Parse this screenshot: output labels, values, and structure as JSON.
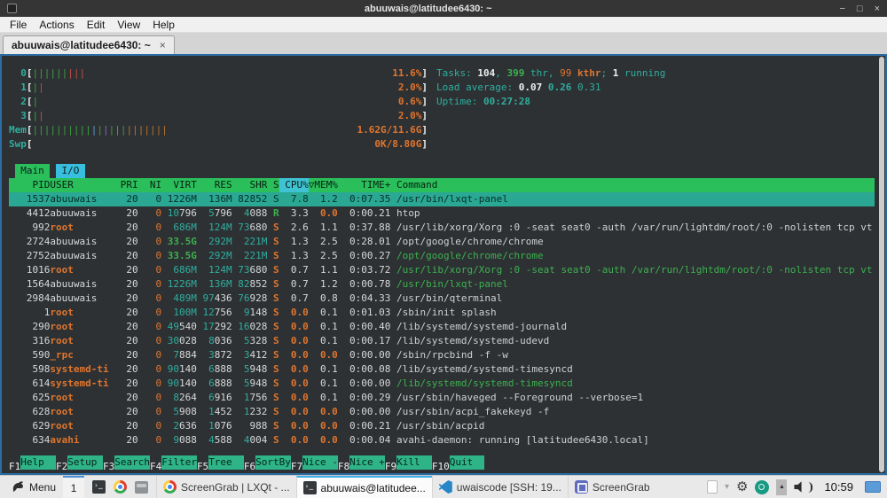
{
  "colors": {
    "terminal_bg": "#2d3134",
    "terminal_border_blue": "#2d6ca3",
    "header_green": "#2abf5b",
    "sort_col_cyan": "#3fc2d4",
    "io_tab_cyan": "#38bfe0",
    "selection_teal": "#2aa893",
    "fnlabel_teal": "#2eb487",
    "text_teal": "#2fae9e",
    "text_green": "#3db04f",
    "text_orange": "#e0752d",
    "taskbar_accent_blue": "#3daee9"
  },
  "window": {
    "title": "abuuwais@latitudee6430: ~",
    "controls": [
      "−",
      "□",
      "×"
    ]
  },
  "menubar": {
    "items": [
      "File",
      "Actions",
      "Edit",
      "View",
      "Help"
    ]
  },
  "tabbar": {
    "tabs": [
      {
        "label": "abuuwais@latitudee6430: ~",
        "close": "×",
        "active": true
      }
    ]
  },
  "htop": {
    "meters": [
      {
        "label": "0",
        "pct": "11.6%",
        "bars": [
          "g",
          "g",
          "g",
          "g",
          "g",
          "g",
          "r",
          "r",
          "r"
        ]
      },
      {
        "label": "1",
        "pct": "2.0%",
        "bars": [
          "g",
          "r"
        ]
      },
      {
        "label": "2",
        "pct": "0.6%",
        "bars": [
          "g"
        ]
      },
      {
        "label": "3",
        "pct": "2.0%",
        "bars": [
          "g",
          "r"
        ]
      },
      {
        "label": "Mem",
        "pct": "1.62G/11.6G",
        "bars": [
          "g",
          "g",
          "g",
          "g",
          "g",
          "g",
          "g",
          "g",
          "g",
          "g",
          "b",
          "g",
          "p",
          "g",
          "o",
          "g",
          "o",
          "o",
          "o",
          "o",
          "o",
          "o",
          "o"
        ]
      },
      {
        "label": "Swp",
        "pct": "0K/8.80G",
        "bars": []
      }
    ],
    "info_lines": [
      {
        "name": "tasks-summary",
        "spans": [
          [
            "Tasks: ",
            "t"
          ],
          [
            "104",
            "wb"
          ],
          [
            ", ",
            "t"
          ],
          [
            "399",
            "gb"
          ],
          [
            " thr, ",
            "t"
          ],
          [
            "99",
            "o"
          ],
          [
            " kthr",
            "ob"
          ],
          [
            "; ",
            "t"
          ],
          [
            "1",
            "wb"
          ],
          [
            " running",
            "t"
          ]
        ]
      },
      {
        "name": "load-average",
        "spans": [
          [
            "Load average: ",
            "t"
          ],
          [
            "0.07",
            "wb"
          ],
          [
            " ",
            "t"
          ],
          [
            "0.26",
            "tb"
          ],
          [
            " ",
            "t"
          ],
          [
            "0.31",
            "t"
          ]
        ]
      },
      {
        "name": "uptime",
        "spans": [
          [
            "Uptime: ",
            "t"
          ],
          [
            "00:27:28",
            "tb"
          ]
        ]
      }
    ],
    "tabs": [
      {
        "label": "Main",
        "style": "green"
      },
      {
        "label": "I/O",
        "style": "cyan"
      }
    ],
    "columns": [
      {
        "label": "PID",
        "w": 7,
        "align": "r"
      },
      {
        "label": "USER",
        "w": 11,
        "align": "l",
        "pad": 1
      },
      {
        "label": "PRI",
        "w": 4,
        "align": "r"
      },
      {
        "label": "NI",
        "w": 4,
        "align": "r"
      },
      {
        "label": "VIRT",
        "w": 6,
        "align": "r"
      },
      {
        "label": "RES",
        "w": 6,
        "align": "r"
      },
      {
        "label": "SHR",
        "w": 6,
        "align": "r"
      },
      {
        "label": "S",
        "w": 2,
        "align": "r"
      },
      {
        "label": "CPU%",
        "w": 5,
        "align": "r",
        "sort": true
      },
      {
        "label": "▽MEM%",
        "w": 5,
        "align": "r"
      },
      {
        "label": "TIME+",
        "w": 9,
        "align": "r"
      },
      {
        "label": "Command",
        "w": 0,
        "align": "l",
        "flex": true
      }
    ],
    "rows": [
      {
        "pid": "1537",
        "user": "abuuwais",
        "pri": "20",
        "ni": "0",
        "virt": "1226M",
        "res": "136M",
        "shr": "82852",
        "st": "S",
        "cpu": "7.8",
        "mem": "1.2",
        "time": "0:07.35",
        "cmd": "/usr/bin/lxqt-panel",
        "sel": true
      },
      {
        "pid": "4412",
        "user": "abuuwais",
        "pri": "20",
        "ni": "0",
        "virt": "10796",
        "res": "5796",
        "shr": "4088",
        "st": "R",
        "cpu": "3.3",
        "mem": "0.0",
        "time": "0:00.21",
        "cmd": "htop"
      },
      {
        "pid": "992",
        "user": "root",
        "pri": "20",
        "ni": "0",
        "virt": "686M",
        "res": "124M",
        "shr": "73680",
        "st": "S",
        "cpu": "2.6",
        "mem": "1.1",
        "time": "0:37.88",
        "cmd": "/usr/lib/xorg/Xorg :0 -seat seat0 -auth /var/run/lightdm/root/:0 -nolisten tcp vt"
      },
      {
        "pid": "2724",
        "user": "abuuwais",
        "pri": "20",
        "ni": "0",
        "virt": "33.5G",
        "res": "292M",
        "shr": "221M",
        "st": "S",
        "cpu": "1.3",
        "mem": "2.5",
        "time": "0:28.01",
        "cmd": "/opt/google/chrome/chrome"
      },
      {
        "pid": "2752",
        "user": "abuuwais",
        "pri": "20",
        "ni": "0",
        "virt": "33.5G",
        "res": "292M",
        "shr": "221M",
        "st": "S",
        "cpu": "1.3",
        "mem": "2.5",
        "time": "0:00.27",
        "cmd": "/opt/google/chrome/chrome",
        "green_cmd": true
      },
      {
        "pid": "1016",
        "user": "root",
        "pri": "20",
        "ni": "0",
        "virt": "686M",
        "res": "124M",
        "shr": "73680",
        "st": "S",
        "cpu": "0.7",
        "mem": "1.1",
        "time": "0:03.72",
        "cmd": "/usr/lib/xorg/Xorg :0 -seat seat0 -auth /var/run/lightdm/root/:0 -nolisten tcp vt",
        "green_cmd": true
      },
      {
        "pid": "1564",
        "user": "abuuwais",
        "pri": "20",
        "ni": "0",
        "virt": "1226M",
        "res": "136M",
        "shr": "82852",
        "st": "S",
        "cpu": "0.7",
        "mem": "1.2",
        "time": "0:00.78",
        "cmd": "/usr/bin/lxqt-panel",
        "green_cmd": true
      },
      {
        "pid": "2984",
        "user": "abuuwais",
        "pri": "20",
        "ni": "0",
        "virt": "489M",
        "res": "97436",
        "shr": "76928",
        "st": "S",
        "cpu": "0.7",
        "mem": "0.8",
        "time": "0:04.33",
        "cmd": "/usr/bin/qterminal"
      },
      {
        "pid": "1",
        "user": "root",
        "pri": "20",
        "ni": "0",
        "virt": "100M",
        "res": "12756",
        "shr": "9148",
        "st": "S",
        "cpu": "0.0",
        "mem": "0.1",
        "time": "0:01.03",
        "cmd": "/sbin/init splash"
      },
      {
        "pid": "290",
        "user": "root",
        "pri": "20",
        "ni": "0",
        "virt": "49540",
        "res": "17292",
        "shr": "16028",
        "st": "S",
        "cpu": "0.0",
        "mem": "0.1",
        "time": "0:00.40",
        "cmd": "/lib/systemd/systemd-journald"
      },
      {
        "pid": "316",
        "user": "root",
        "pri": "20",
        "ni": "0",
        "virt": "30028",
        "res": "8036",
        "shr": "5328",
        "st": "S",
        "cpu": "0.0",
        "mem": "0.1",
        "time": "0:00.17",
        "cmd": "/lib/systemd/systemd-udevd"
      },
      {
        "pid": "590",
        "user": "_rpc",
        "pri": "20",
        "ni": "0",
        "virt": "7884",
        "res": "3872",
        "shr": "3412",
        "st": "S",
        "cpu": "0.0",
        "mem": "0.0",
        "time": "0:00.00",
        "cmd": "/sbin/rpcbind -f -w"
      },
      {
        "pid": "598",
        "user": "systemd-ti",
        "pri": "20",
        "ni": "0",
        "virt": "90140",
        "res": "6888",
        "shr": "5948",
        "st": "S",
        "cpu": "0.0",
        "mem": "0.1",
        "time": "0:00.08",
        "cmd": "/lib/systemd/systemd-timesyncd"
      },
      {
        "pid": "614",
        "user": "systemd-ti",
        "pri": "20",
        "ni": "0",
        "virt": "90140",
        "res": "6888",
        "shr": "5948",
        "st": "S",
        "cpu": "0.0",
        "mem": "0.1",
        "time": "0:00.00",
        "cmd": "/lib/systemd/systemd-timesyncd",
        "green_cmd": true
      },
      {
        "pid": "625",
        "user": "root",
        "pri": "20",
        "ni": "0",
        "virt": "8264",
        "res": "6916",
        "shr": "1756",
        "st": "S",
        "cpu": "0.0",
        "mem": "0.1",
        "time": "0:00.29",
        "cmd": "/usr/sbin/haveged --Foreground --verbose=1"
      },
      {
        "pid": "628",
        "user": "root",
        "pri": "20",
        "ni": "0",
        "virt": "5908",
        "res": "1452",
        "shr": "1232",
        "st": "S",
        "cpu": "0.0",
        "mem": "0.0",
        "time": "0:00.00",
        "cmd": "/usr/sbin/acpi_fakekeyd -f"
      },
      {
        "pid": "629",
        "user": "root",
        "pri": "20",
        "ni": "0",
        "virt": "2636",
        "res": "1076",
        "shr": "988",
        "st": "S",
        "cpu": "0.0",
        "mem": "0.0",
        "time": "0:00.21",
        "cmd": "/usr/sbin/acpid"
      },
      {
        "pid": "634",
        "user": "avahi",
        "pri": "20",
        "ni": "0",
        "virt": "9088",
        "res": "4588",
        "shr": "4004",
        "st": "S",
        "cpu": "0.0",
        "mem": "0.0",
        "time": "0:00.04",
        "cmd": "avahi-daemon: running [latitudee6430.local]"
      }
    ],
    "current_user": "abuuwais",
    "fnkeys": [
      [
        "F1",
        "Help"
      ],
      [
        "F2",
        "Setup"
      ],
      [
        "F3",
        "Search"
      ],
      [
        "F4",
        "Filter"
      ],
      [
        "F5",
        "Tree"
      ],
      [
        "F6",
        "SortBy"
      ],
      [
        "F7",
        "Nice -"
      ],
      [
        "F8",
        "Nice +"
      ],
      [
        "F9",
        "Kill"
      ],
      [
        "F10",
        "Quit"
      ]
    ]
  },
  "taskbar": {
    "menu_label": "Menu",
    "workspace": "1",
    "quicklaunch": [
      "terminal",
      "chrome",
      "filemanager"
    ],
    "tasks": [
      {
        "icon": "chrome",
        "label": "ScreenGrab | LXQt - ..."
      },
      {
        "icon": "terminal",
        "label": "abuuwais@latitudee...",
        "active": true
      },
      {
        "icon": "vscode",
        "label": "uwaiscode [SSH: 19..."
      },
      {
        "icon": "screengrab",
        "label": "ScreenGrab"
      }
    ],
    "tray": [
      "clipboard",
      "chevron-down",
      "gear",
      "network-green",
      "volume-step",
      "speaker"
    ],
    "clock": "10:59"
  }
}
